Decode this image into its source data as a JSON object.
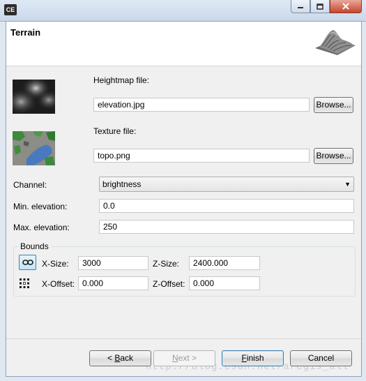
{
  "window": {
    "app_icon_text": "CE"
  },
  "header": {
    "title": "Terrain"
  },
  "heightmap": {
    "label": "Heightmap file:",
    "value": "elevation.jpg",
    "browse_label": "Browse..."
  },
  "texture": {
    "label": "Texture file:",
    "value": "topo.png",
    "browse_label": "Browse..."
  },
  "channel": {
    "label": "Channel:",
    "value": "brightness"
  },
  "min_elevation": {
    "label": "Min. elevation:",
    "value": "0.0"
  },
  "max_elevation": {
    "label": "Max. elevation:",
    "value": "250"
  },
  "bounds": {
    "title": "Bounds",
    "x_size_label": "X-Size:",
    "x_size_value": "3000",
    "z_size_label": "Z-Size:",
    "z_size_value": "2400.000",
    "x_offset_label": "X-Offset:",
    "x_offset_value": "0.000",
    "z_offset_label": "Z-Offset:",
    "z_offset_value": "0.000"
  },
  "footer": {
    "back_prefix": "< ",
    "back_mnemonic": "B",
    "back_rest": "ack",
    "next_mnemonic": "N",
    "next_rest": "ext >",
    "finish_mnemonic": "F",
    "finish_rest": "inish",
    "cancel_label": "Cancel"
  },
  "watermark": "http://blog.csdn.net/arcgis_all"
}
